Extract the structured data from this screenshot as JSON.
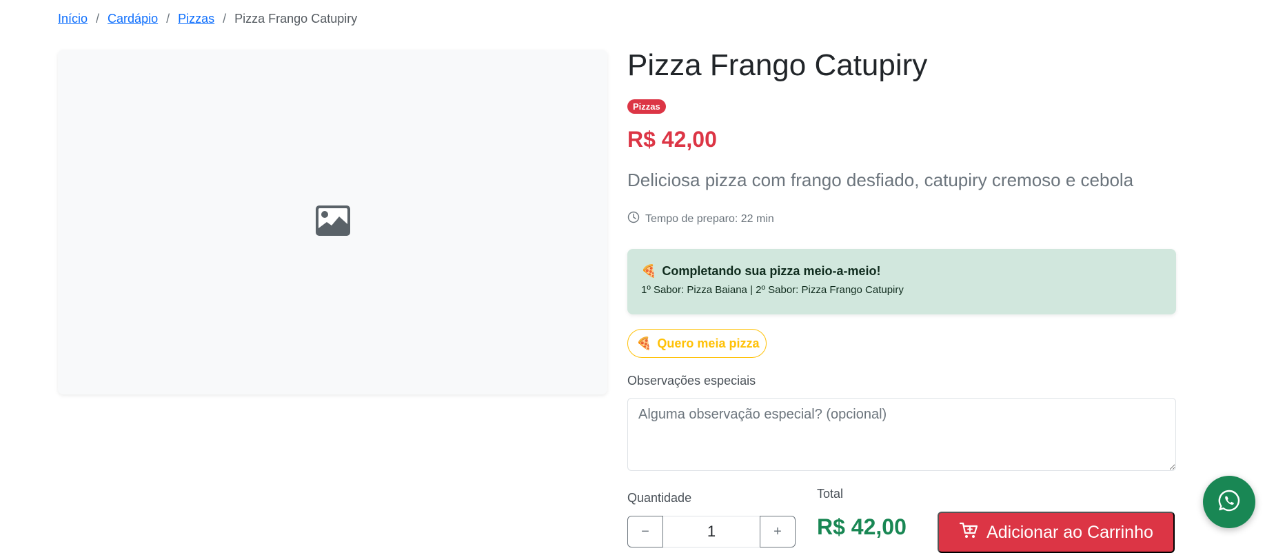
{
  "breadcrumb": {
    "home": "Início",
    "menu": "Cardápio",
    "category": "Pizzas",
    "current": "Pizza Frango Catupiry",
    "separator": "/"
  },
  "product": {
    "image_placeholder_icon": "image-icon",
    "title": "Pizza Frango Catupiry",
    "badge": "Pizzas",
    "price": "R$ 42,00",
    "description": "Deliciosa pizza com frango desfiado, catupiry cremoso e cebola",
    "prep_time": "Tempo de preparo: 22 min"
  },
  "half_pizza": {
    "emoji": "🍕",
    "heading": "Completando sua pizza meio-a-meio!",
    "flavors": "1º Sabor: Pizza Baiana | 2º Sabor: Pizza Frango Catupiry",
    "button_label": "Quero meia pizza"
  },
  "observations": {
    "label": "Observações especiais",
    "placeholder": "Alguma observação especial? (opcional)"
  },
  "quantity": {
    "label": "Quantidade",
    "value": "1",
    "minus": "−",
    "plus": "+"
  },
  "total": {
    "label": "Total",
    "value": "R$ 42,00"
  },
  "cart_button": {
    "label": "Adicionar ao Carrinho",
    "icon": "cart-plus-icon"
  },
  "floating": {
    "icon": "whatsapp-icon"
  },
  "colors": {
    "primary_red": "#dc3545",
    "success_green": "#198754",
    "warning_yellow": "#ffc107",
    "info_green_bg": "#d1e7dd",
    "link_blue": "#0d6efd"
  }
}
